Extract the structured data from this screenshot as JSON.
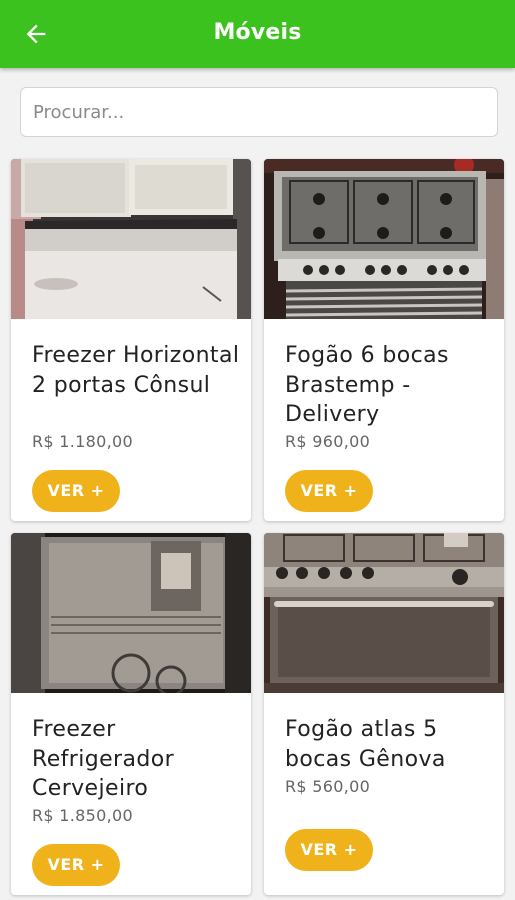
{
  "appbar": {
    "title": "Móveis",
    "back_icon": "arrow-left-icon",
    "color": "#3cc21e"
  },
  "search": {
    "placeholder": "Procurar...",
    "value": ""
  },
  "products": [
    {
      "name": "Freezer Horizontal 2 portas Cônsul",
      "price": "R$ 1.180,00",
      "button": "VER +",
      "image": "chest-freezer-photo"
    },
    {
      "name": "Fogão 6 bocas Brastemp - Delivery",
      "price": "R$ 960,00",
      "button": "VER +",
      "image": "stove-top-photo"
    },
    {
      "name": "Freezer Refrigerador Cervejeiro",
      "price": "R$ 1.850,00",
      "button": "VER +",
      "image": "glass-door-fridge-photo"
    },
    {
      "name": "Fogão atlas 5 bocas Gênova",
      "price": "R$ 560,00",
      "button": "VER +",
      "image": "stove-oven-photo"
    }
  ],
  "colors": {
    "accent": "#f0b21a",
    "primary": "#3cc21e"
  }
}
